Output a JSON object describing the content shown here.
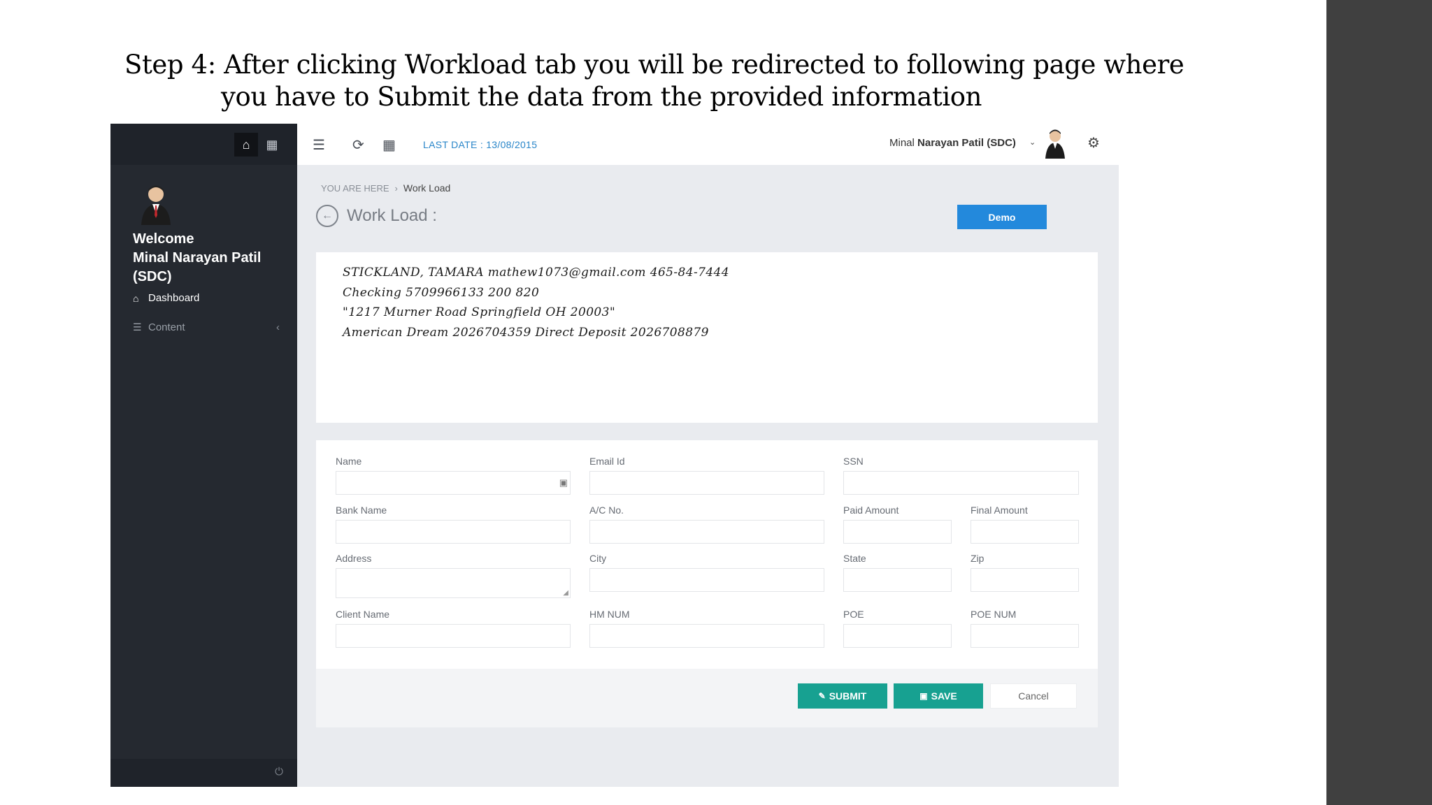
{
  "slide": {
    "heading_line1": "Step 4: After clicking Workload tab you will be redirected to following page where",
    "heading_line2": "you have to Submit the data from the provided information"
  },
  "sidebar": {
    "welcome": "Welcome",
    "user_name": "Minal Narayan Patil (SDC)",
    "items": [
      {
        "label": "Dashboard",
        "icon": "home-icon"
      },
      {
        "label": "Content",
        "icon": "list-icon"
      }
    ]
  },
  "topbar": {
    "last_date": "LAST DATE : 13/08/2015",
    "user_first": "Minal",
    "user_rest": "Narayan Patil (SDC)"
  },
  "breadcrumb": {
    "prefix": "YOU ARE HERE",
    "current": "Work Load"
  },
  "page": {
    "title": "Work Load :",
    "demo_label": "Demo"
  },
  "info_lines": [
    "STICKLAND, TAMARA mathew1073@gmail.com 465-84-7444",
    "Checking 5709966133 200 820",
    "\"1217 Murner Road Springfield OH 20003\"",
    "American Dream 2026704359 Direct Deposit 2026708879"
  ],
  "form": {
    "labels": {
      "name": "Name",
      "email": "Email Id",
      "ssn": "SSN",
      "bank": "Bank Name",
      "acno": "A/C No.",
      "paid": "Paid Amount",
      "final": "Final Amount",
      "address": "Address",
      "city": "City",
      "state": "State",
      "zip": "Zip",
      "client": "Client Name",
      "hm": "HM NUM",
      "poe": "POE",
      "poenum": "POE NUM"
    },
    "buttons": {
      "submit": "SUBMIT",
      "save": "SAVE",
      "cancel": "Cancel"
    }
  },
  "colors": {
    "sidebar": "#252930",
    "accent_blue": "#2389dc",
    "teal": "#17a191",
    "date_blue": "#2a86c9"
  }
}
